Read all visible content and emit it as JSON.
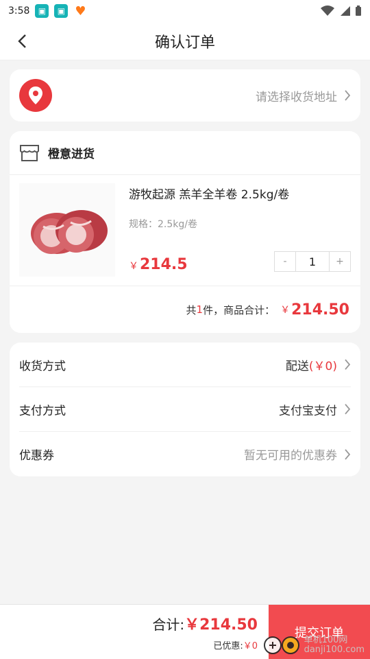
{
  "status_bar": {
    "time": "3:58"
  },
  "nav": {
    "title": "确认订单"
  },
  "address": {
    "placeholder": "请选择收货地址"
  },
  "store": {
    "name": "橙意进货",
    "item": {
      "title": "游牧起源 羔羊全羊卷 2.5kg/卷",
      "spec": "规格：2.5kg/卷",
      "currency": "￥",
      "price": "214.5",
      "qty": "1",
      "minus": "-",
      "plus": "+"
    },
    "summary": {
      "prefix": "共",
      "count": "1",
      "suffix": "件，商品合计：",
      "currency": "￥",
      "total": "214.50"
    }
  },
  "options": [
    {
      "label": "收货方式",
      "value": "配送",
      "extra": "(￥0)"
    },
    {
      "label": "支付方式",
      "value": "支付宝支付"
    },
    {
      "label": "优惠券",
      "value": "暂无可用的优惠券"
    }
  ],
  "bottom": {
    "total_label": "合计:",
    "total_value": "￥214.50",
    "discount_label": "已优惠:",
    "discount_value": "￥0",
    "submit_label": "提交订单"
  },
  "watermark": {
    "text1": "单机100网",
    "text2": "danji100.com"
  },
  "colors": {
    "accent": "#e8383d",
    "submit": "#f24b50"
  }
}
